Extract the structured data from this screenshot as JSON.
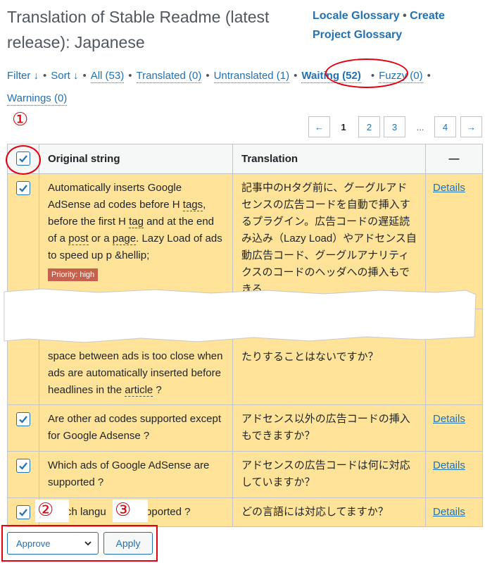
{
  "page": {
    "title": "Translation of Stable Readme (latest release): Japanese",
    "glossary_locale": "Locale Glossary",
    "glossary_sep": "•",
    "glossary_project": "Create Project Glossary"
  },
  "filters": {
    "filter": "Filter ↓",
    "sort": "Sort ↓",
    "all": "All (53)",
    "translated": "Translated (0)",
    "untranslated": "Untranslated (1)",
    "waiting": "Waiting (52)",
    "fuzzy": "Fuzzy (0)",
    "warnings": "Warnings (0)",
    "dot": "•"
  },
  "annotations": {
    "n1": "①",
    "n2": "②",
    "n3": "③",
    "color": "#e3000f"
  },
  "pagination": {
    "prev": "←",
    "current": "1",
    "p2": "2",
    "p3": "3",
    "ellipsis": "...",
    "p4": "4",
    "next": "→"
  },
  "table": {
    "headers": {
      "original": "Original string",
      "translation": "Translation",
      "actions": "—"
    },
    "details_label": "Details",
    "row1": {
      "orig_a": "Automatically inserts Google AdSense ad codes before H ",
      "g_tags": "tags",
      "orig_b": ", before the first H ",
      "g_tag": "tag",
      "orig_c": " and at the end of a ",
      "g_post": "post",
      "orig_d": " or a ",
      "g_page": "page",
      "orig_e": ". Lazy Load of ads to speed up p &hellip;",
      "priority": "Priority: high",
      "translation": "記事中のHタグ前に、グーグルアドセンスの広告コードを自動で挿入するプラグイン。広告コードの遅延読み込み（Lazy Load）やアドセンス自動広告コード、グーグルアナリティクスのコードのヘッダへの挿入もできる。"
    },
    "row2": {
      "orig_a": "space between ads is too close when ads are automatically inserted before headlines in the ",
      "g_article": "article",
      "orig_b": " ?",
      "translation": "たりすることはないですか？"
    },
    "row3": {
      "original": "Are other ad codes supported except for Google Adsense ?",
      "translation": "アドセンス以外の広告コードの挿入もできますか？"
    },
    "row4": {
      "original": "Which ads of Google AdSense are supported ?",
      "translation": "アドセンスの広告コードは何に対応していますか？"
    },
    "row5": {
      "orig_a": "ch langu",
      "orig_b": "upported ?",
      "translation": "どの言語には対応してますか？"
    }
  },
  "bulk": {
    "action": "Approve",
    "apply": "Apply"
  },
  "colors": {
    "link": "#2271b1",
    "row_bg": "#ffe399",
    "priority_bg": "#c6614d"
  }
}
